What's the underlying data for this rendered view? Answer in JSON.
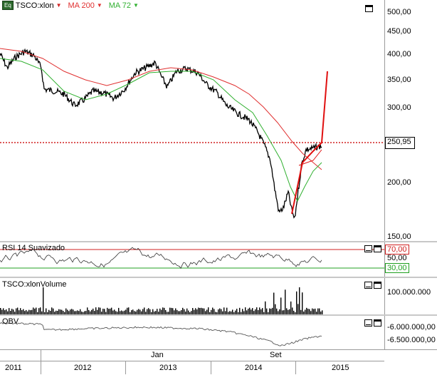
{
  "price_pane": {
    "symbol": "TSCO:xlon",
    "ma200_label": "MA 200",
    "ma72_label": "MA 72",
    "current_price": "250,95",
    "y_ticks": [
      "500,00",
      "450,00",
      "400,00",
      "350,00",
      "300,00",
      "250,00",
      "200,00",
      "150,00"
    ],
    "colors": {
      "price": "#000000",
      "ma200": "#e03030",
      "ma72": "#30b030",
      "projection": "#e01010"
    }
  },
  "rsi_pane": {
    "label": "RSI 14 Suavizado",
    "upper_level": "70,00",
    "mid_level": "50,00",
    "lower_level": "30,00",
    "colors": {
      "upper": "#d02020",
      "lower": "#20a020"
    }
  },
  "volume_pane": {
    "label": "TSCO:xlonVolume",
    "y_tick": "100.000.000"
  },
  "obv_pane": {
    "label": "OBV",
    "y_ticks": [
      "-6.000.000,00",
      "-6.500.000,00"
    ]
  },
  "time_axis": {
    "month_labels": [
      "Jan",
      "Set"
    ],
    "year_labels": [
      "2011",
      "2012",
      "2013",
      "2014",
      "2015"
    ]
  }
}
